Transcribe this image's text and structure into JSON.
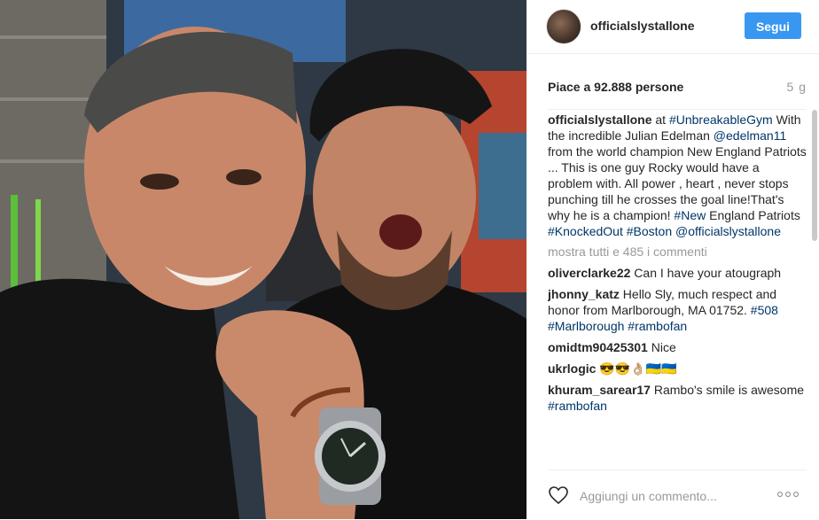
{
  "post": {
    "username": "officialslystallone",
    "follow_label": "Segui",
    "likes_text": "Piace a 92.888 persone",
    "age": "5 g"
  },
  "caption": {
    "username": "officialslystallone",
    "at": "at",
    "location": "#UnbreakableGym",
    "text1": "With the incredible Julian Edelman",
    "mention1": "@edelman11",
    "text2": "from the world champion New England Patriots ... This is one guy Rocky would have a problem with. All power , heart , never stops punching till he crosses the goal line!That's why he is a champion!",
    "tag_new": "#New",
    "text3": "England Patriots",
    "tag_ko": "#KnockedOut",
    "tag_boston": "#Boston",
    "mention2": "@officialslystallone"
  },
  "load_more": "mostra tutti e 485 i commenti",
  "comments": [
    {
      "user": "oliverclarke22",
      "text": "Can I have your atougraph"
    },
    {
      "user": "jhonny_katz",
      "text": "Hello Sly, much respect and honor from Marlborough, MA 01752.",
      "tags": [
        "#508",
        "#Marlborough",
        "#rambofan"
      ]
    },
    {
      "user": "omidtm90425301",
      "text": "Nice"
    },
    {
      "user": "ukrlogic",
      "text": "😎😎👌🏼🇺🇦🇺🇦"
    },
    {
      "user": "khuram_sarear17",
      "text": "Rambo's smile is awesome",
      "tags": [
        "#rambofan"
      ]
    }
  ],
  "footer": {
    "placeholder": "Aggiungi un commento..."
  },
  "icons": {
    "like": "heart-icon",
    "options": "more-options-icon"
  },
  "colors": {
    "follow_button": "#3897f0",
    "hashtag": "#003569",
    "muted": "#999999"
  }
}
